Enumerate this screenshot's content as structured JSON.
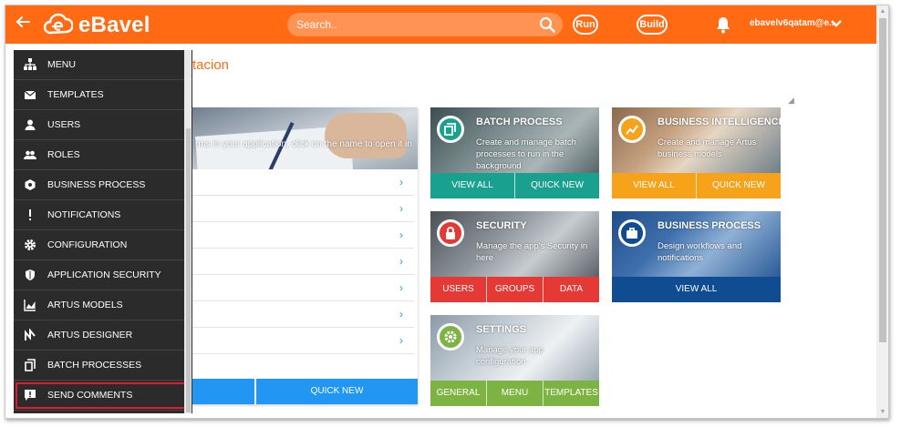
{
  "header": {
    "brand": "eBavel",
    "search_placeholder": "Search..",
    "run_label": "Run",
    "build_label": "Build",
    "user_email": "ebavelv6qatam@e...",
    "color": "#ff6a13"
  },
  "page": {
    "title": "tacion"
  },
  "hero": {
    "text": "rms in your application, click on the name to open it in",
    "button_right": "QUICK NEW",
    "button_left": "",
    "row_count": 7
  },
  "tiles": {
    "batch": {
      "title": "BATCH PROCESS",
      "desc": "Create and manage batch processes to run in the background",
      "buttons": [
        "VIEW ALL",
        "QUICK NEW"
      ],
      "color": "#1aa08f"
    },
    "bi": {
      "title": "BUSINESS INTELLIGENCE",
      "desc": "Create and manage Artus business models",
      "buttons": [
        "VIEW ALL",
        "QUICK NEW"
      ],
      "color": "#f7a21b"
    },
    "security": {
      "title": "SECURITY",
      "desc": "Manage the app's Security in here",
      "buttons": [
        "USERS",
        "GROUPS",
        "DATA"
      ],
      "color": "#e53935"
    },
    "bp": {
      "title": "BUSINESS PROCESS",
      "desc": "Design workflows and notifications",
      "buttons": [
        "VIEW ALL"
      ],
      "color": "#0f4c92"
    },
    "settings": {
      "title": "SETTINGS",
      "desc": "Manage your app configuration",
      "buttons": [
        "GENERAL",
        "MENU",
        "TEMPLATES"
      ],
      "color": "#7cb342"
    }
  },
  "menu": {
    "items": [
      {
        "label": "MENU",
        "icon": "sitemap-icon"
      },
      {
        "label": "TEMPLATES",
        "icon": "envelope-icon"
      },
      {
        "label": "USERS",
        "icon": "user-icon"
      },
      {
        "label": "ROLES",
        "icon": "users-icon"
      },
      {
        "label": "BUSINESS PROCESS",
        "icon": "process-icon"
      },
      {
        "label": "NOTIFICATIONS",
        "icon": "exclamation-icon"
      },
      {
        "label": "CONFIGURATION",
        "icon": "gear-icon"
      },
      {
        "label": "APPLICATION SECURITY",
        "icon": "shield-icon"
      },
      {
        "label": "ARTUS MODELS",
        "icon": "area-chart-icon"
      },
      {
        "label": "ARTUS DESIGNER",
        "icon": "designer-icon"
      },
      {
        "label": "BATCH PROCESSES",
        "icon": "batch-icon"
      },
      {
        "label": "SEND COMMENTS",
        "icon": "comment-icon"
      }
    ]
  }
}
